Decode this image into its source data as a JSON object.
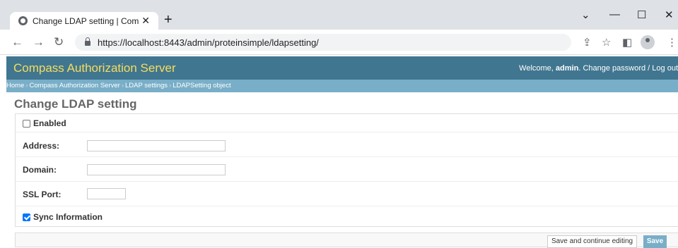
{
  "browser": {
    "tab_title": "Change LDAP setting | Compass",
    "tab_close": "✕",
    "new_tab": "+",
    "minimize": "—",
    "maximize": "☐",
    "close_window": "✕",
    "back": "←",
    "forward": "→",
    "reload": "↻",
    "url": "https://localhost:8443/admin/proteinsimple/ldapsetting/",
    "share_icon": "⇪",
    "star_icon": "☆",
    "sidepanel_icon": "◧",
    "menu_icon": "⋮"
  },
  "header": {
    "site_title": "Compass Authorization Server",
    "welcome": "Welcome,",
    "username": "admin",
    "change_password": "Change password",
    "separator": "/",
    "logout": "Log out"
  },
  "breadcrumbs": {
    "home": "Home",
    "app": "Compass Authorization Server",
    "model": "LDAP settings",
    "current": "LDAPSetting object",
    "sep": "›"
  },
  "page_title": "Change LDAP setting",
  "form": {
    "enabled_label": "Enabled",
    "enabled_checked": false,
    "address_label": "Address:",
    "address_value": "",
    "domain_label": "Domain:",
    "domain_value": "",
    "ssl_port_label": "SSL Port:",
    "ssl_port_value": "",
    "sync_label": "Sync Information",
    "sync_checked": true
  },
  "actions": {
    "save_continue": "Save and continue editing",
    "save": "Save"
  }
}
